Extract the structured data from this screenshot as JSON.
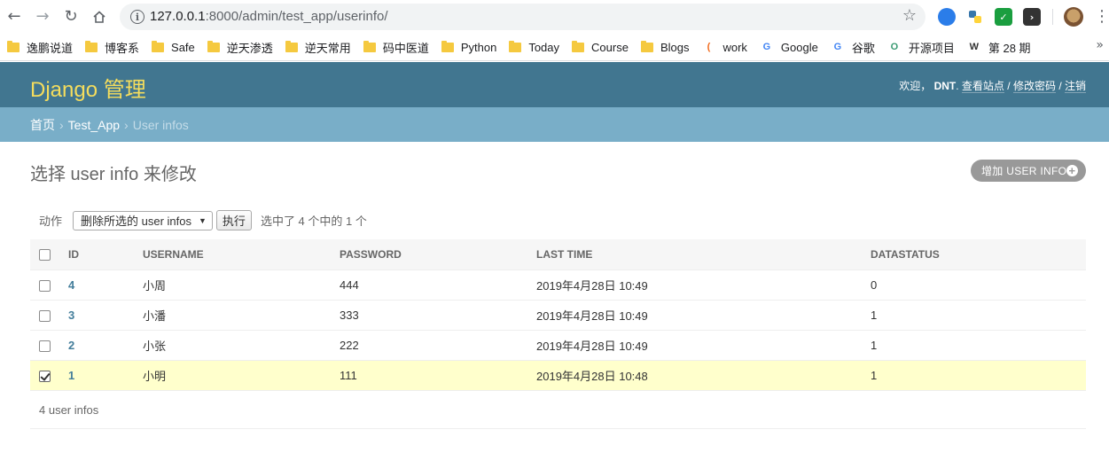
{
  "browser": {
    "url_host": "127.0.0.1",
    "url_path": ":8000/admin/test_app/userinfo/",
    "bookmarks": [
      {
        "label": "逸鹏说道",
        "icon": "folder-icon"
      },
      {
        "label": "博客系",
        "icon": "folder-icon"
      },
      {
        "label": "Safe",
        "icon": "folder-icon"
      },
      {
        "label": "逆天渗透",
        "icon": "folder-icon"
      },
      {
        "label": "逆天常用",
        "icon": "folder-icon"
      },
      {
        "label": "码中医道",
        "icon": "folder-icon"
      },
      {
        "label": "Python",
        "icon": "folder-icon"
      },
      {
        "label": "Today",
        "icon": "folder-icon"
      },
      {
        "label": "Course",
        "icon": "folder-icon"
      },
      {
        "label": "Blogs",
        "icon": "folder-icon"
      },
      {
        "label": "work",
        "icon": "orange-arc-icon"
      },
      {
        "label": "Google",
        "icon": "google-translate-icon"
      },
      {
        "label": "谷歌",
        "icon": "google-g-icon"
      },
      {
        "label": "开源项目",
        "icon": "open-source-icon"
      },
      {
        "label": "第 28 期",
        "icon": "w-circle-icon"
      }
    ]
  },
  "header": {
    "brand": "Django 管理",
    "welcome": "欢迎，",
    "user": "DNT",
    "view_site": "查看站点",
    "change_password": "修改密码",
    "logout": "注销"
  },
  "breadcrumbs": {
    "home": "首页",
    "app": "Test_App",
    "current": "User infos"
  },
  "content": {
    "title": "选择 user info 来修改",
    "add_button": "增加 USER INFO"
  },
  "actions": {
    "label": "动作",
    "selected_option": "删除所选的 user infos",
    "go_button": "执行",
    "counter": "选中了 4 个中的 1 个"
  },
  "table": {
    "headers": [
      "ID",
      "USERNAME",
      "PASSWORD",
      "LAST TIME",
      "DATASTATUS"
    ],
    "rows": [
      {
        "id": "4",
        "username": "小周",
        "password": "444",
        "last_time": "2019年4月28日 10:49",
        "datastatus": "0",
        "checked": false
      },
      {
        "id": "3",
        "username": "小潘",
        "password": "333",
        "last_time": "2019年4月28日 10:49",
        "datastatus": "1",
        "checked": false
      },
      {
        "id": "2",
        "username": "小张",
        "password": "222",
        "last_time": "2019年4月28日 10:49",
        "datastatus": "1",
        "checked": false
      },
      {
        "id": "1",
        "username": "小明",
        "password": "111",
        "last_time": "2019年4月28日 10:48",
        "datastatus": "1",
        "checked": true
      }
    ]
  },
  "paginator": {
    "text": "4 user infos"
  },
  "colors": {
    "header_bg": "#417690",
    "brand_yellow": "#f5dd5d",
    "breadcrumb_bg": "#79aec8",
    "selected_row": "#ffffcc",
    "link": "#447e9b"
  }
}
